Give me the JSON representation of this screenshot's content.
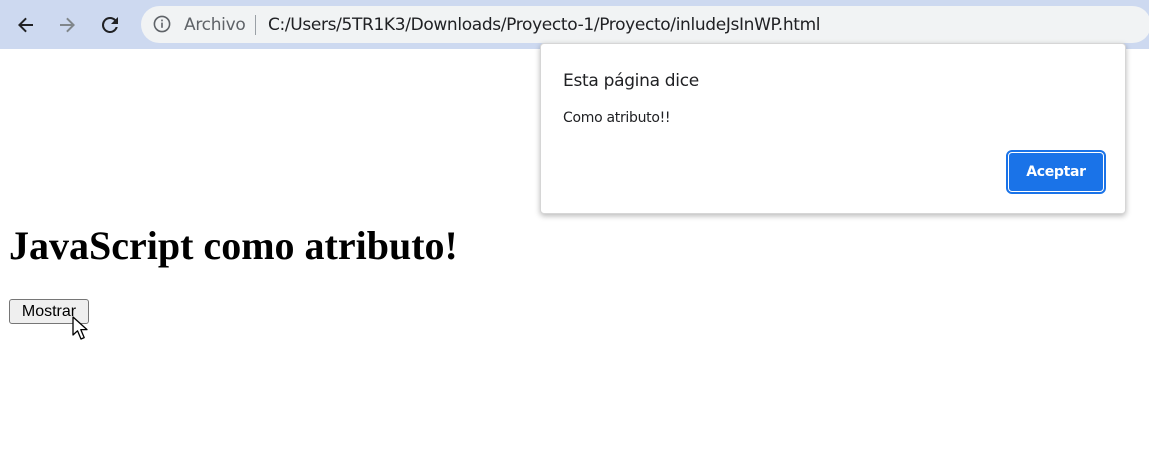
{
  "browser": {
    "omnibox": {
      "security_label": "Archivo",
      "url": "C:/Users/5TR1K3/Downloads/Proyecto-1/Proyecto/inludeJsInWP.html"
    },
    "icons": {
      "back": "back-arrow-icon",
      "forward": "forward-arrow-icon",
      "reload": "reload-icon",
      "info": "info-icon"
    },
    "colors": {
      "toolbar_bg": "#cdd9f0",
      "omnibox_bg": "#f1f3f4"
    }
  },
  "page": {
    "heading": "JavaScript como atributo!",
    "show_button_label": "Mostrar"
  },
  "alert": {
    "title": "Esta página dice",
    "message": "Como atributo!!",
    "accept_label": "Aceptar",
    "accent_color": "#1a73e8"
  }
}
